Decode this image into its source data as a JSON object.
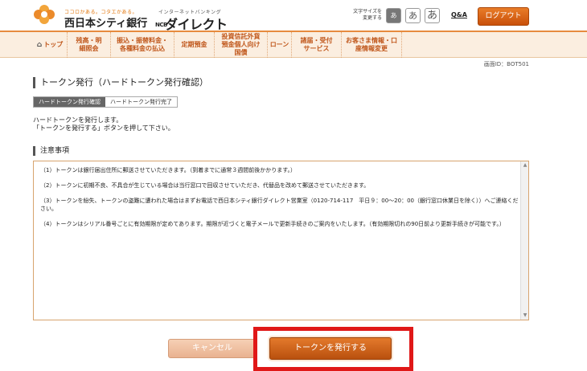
{
  "header": {
    "tagline": "ココロかある。コタエかある。",
    "bank_name": "西日本シティ銀行",
    "net_banking_label": "インターネットバンキング",
    "direct_prefix": "NCB",
    "direct_label": "ダイレクト",
    "font_size_label_line1": "文字サイズを",
    "font_size_label_line2": "変更する",
    "font_sizes": [
      "あ",
      "あ",
      "あ"
    ],
    "qa_label": "Q&A",
    "logout_label": "ログアウト",
    "accent_color": "#e2770e"
  },
  "nav": {
    "items": [
      {
        "label": "トップ",
        "icon": "home-icon"
      },
      {
        "label": "残高・明細照会"
      },
      {
        "label": "振込・振替料金・各種料金の払込"
      },
      {
        "label": "定期預金"
      },
      {
        "label": "投資信託外貨預金個人向け国債"
      },
      {
        "label": "ローン"
      },
      {
        "label": "諸届・受付サービス"
      },
      {
        "label": "お客さま情報・口座情報変更"
      }
    ]
  },
  "screen_id": "画面ID：BOT501",
  "page_title": "トークン発行（ハードトークン発行確認）",
  "steps": [
    "ハードトークン発行確認",
    "ハードトークン発行完了"
  ],
  "instructions": {
    "line1": "ハードトークンを発行します。",
    "line2": "「トークンを発行する」ボタンを押して下さい。"
  },
  "notes": {
    "title": "注意事項",
    "items": [
      "（1）トークンは銀行届出住所に郵送させていただきます。（到着までに通常３週間前後かかります。）",
      "（2）トークンに初期不良、不具合が生じている場合は当行窓口で回収させていただき、代替品を改めて郵送させていただきます。",
      "（3）トークンを紛失、トークンの盗難に遭われた場合はまずお電話で西日本シティ銀行ダイレクト営業室（0120-714-117　平日９：00〜20：00（銀行窓口休業日を除く））へご連絡ください。",
      "（4）トークンはシリアル番号ごとに有効期限が定めてあります。期限が近づくと電子メールで更新手続きのご案内をいたします。（有効期限切れの90日前より更新手続きが可能です。）"
    ]
  },
  "buttons": {
    "cancel_label": "キャンセル",
    "issue_label": "トークンを発行する"
  }
}
